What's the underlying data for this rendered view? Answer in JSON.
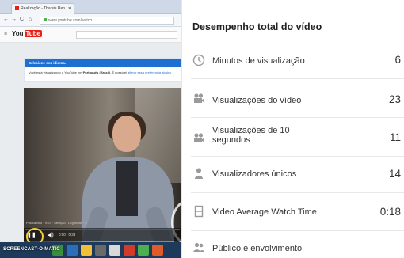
{
  "browser": {
    "tab_title": "Realização - Tharsis Ren...",
    "url": "www.youtube.com/watch",
    "nav_glyphs": [
      "←",
      "→",
      "C",
      "⌂"
    ]
  },
  "youtube": {
    "logo_you": "You",
    "logo_tube": "Tube",
    "language_notice_title": "Selecione seu idioma.",
    "language_notice_text": "Você está visualizando o YouTube em",
    "language_notice_lang": "Português (Brasil).",
    "language_notice_tail": "É possível",
    "language_notice_link": "alterar essa preferência abaixo.",
    "video_caption": "Produzindo · 9:23 · Seleção · Legendas · ©",
    "video_time": "0:00 / 0:33",
    "progress_fraction": 0.0,
    "watermark": "SCREENCAST-O-MATIC"
  },
  "panel": {
    "title": "Desempenho total do vídeo",
    "rows": [
      {
        "icon": "clock-icon",
        "label": "Minutos de visualização",
        "value": "6"
      },
      {
        "icon": "camera-icon",
        "label": "Visualizações do vídeo",
        "value": "23"
      },
      {
        "icon": "camera-icon",
        "label": "Visualizações de 10 segundos",
        "value": "11"
      },
      {
        "icon": "person-icon",
        "label": "Visualizadores únicos",
        "value": "14"
      },
      {
        "icon": "film-icon",
        "label": "Video Average Watch Time",
        "value": "0:18"
      },
      {
        "icon": "group-icon",
        "label": "Público e envolvimento",
        "value": ""
      }
    ]
  },
  "colors": {
    "youtube_red": "#e62117",
    "notice_blue": "#1f6fd0",
    "taskbar": "#1d3a5a"
  }
}
